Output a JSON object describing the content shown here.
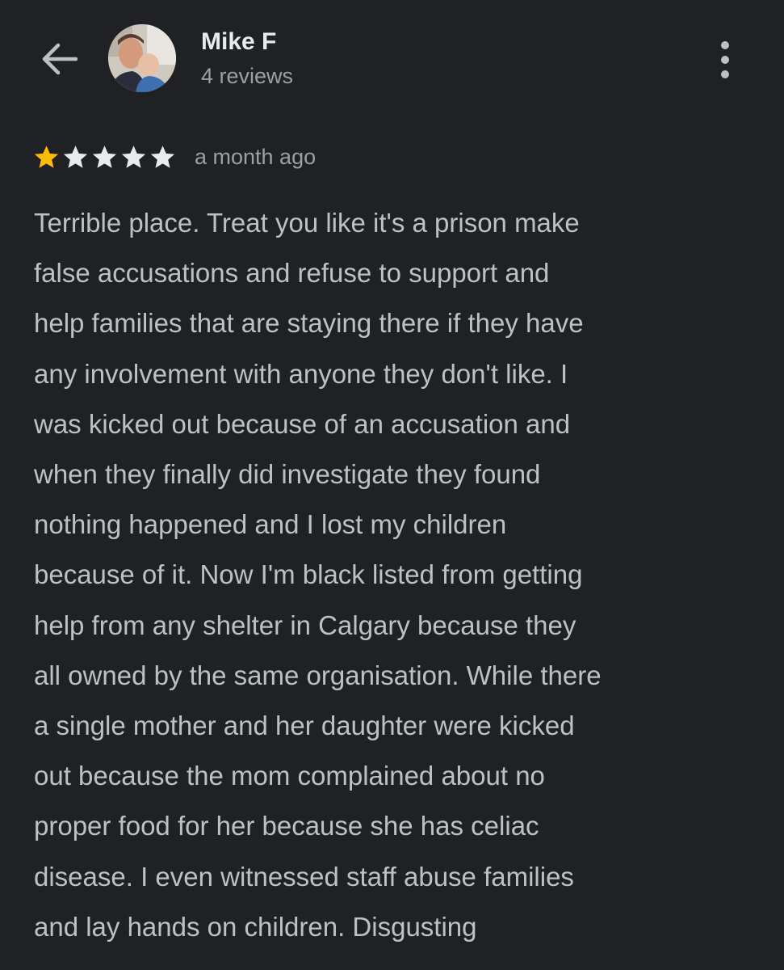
{
  "header": {
    "back_icon": "arrow-left-icon",
    "user_name": "Mike F",
    "review_count": "4 reviews",
    "avatar_icon": "user-avatar",
    "more_icon": "more-vert-icon"
  },
  "review": {
    "rating": 1,
    "max_rating": 5,
    "star_color_filled": "#fbbc04",
    "star_color_empty": "#e8eaed",
    "date": "a month ago",
    "text": "Terrible place. Treat you like it's a prison make\nfalse accusations and refuse to support and\nhelp families that are staying there if they have\nany involvement with anyone they don't like. I\nwas kicked out because of an accusation and\nwhen they finally did investigate they found\nnothing happened and I lost my children\nbecause of it. Now I'm black listed from getting\nhelp from any shelter in Calgary because they\nall owned by the same organisation. While there\na single mother and her daughter were kicked\nout because the mom complained about no\nproper food for her because she has celiac\ndisease. I even witnessed staff abuse families\nand lay hands on children. Disgusting"
  },
  "colors": {
    "background": "#202124",
    "primary_text": "#e8eaed",
    "secondary_text": "#9aa0a6",
    "body_text": "#bdc1c6"
  }
}
